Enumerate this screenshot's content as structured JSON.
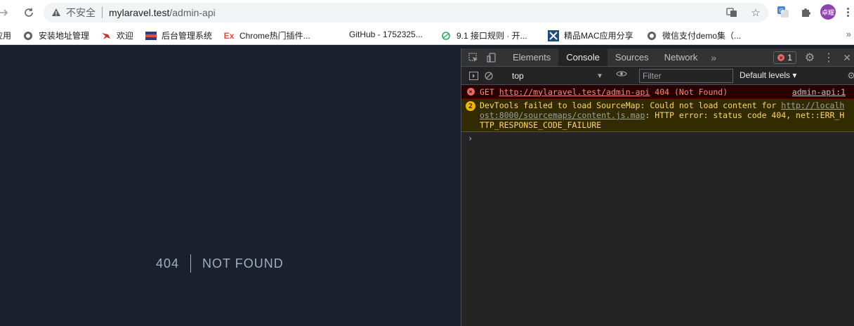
{
  "browser": {
    "security_label": "不安全",
    "url_host": "mylaravel.test",
    "url_path": "/admin-api",
    "avatar_text": "卓耀"
  },
  "bookmarks": [
    {
      "label": "应用",
      "icon": "apps-icon"
    },
    {
      "label": "安装地址管理",
      "icon": "globe-icon"
    },
    {
      "label": "欢迎",
      "icon": "bird-icon"
    },
    {
      "label": "后台管理系统",
      "icon": "flag-icon"
    },
    {
      "label": "Chrome热门插件...",
      "icon": "ex-icon",
      "icon_text": "Ex"
    },
    {
      "label": "GitHub - 1752325...",
      "icon": "none"
    },
    {
      "label": "9.1 接口规则 · 开...",
      "icon": "leaf-icon"
    },
    {
      "label": "精品MAC应用分享",
      "icon": "x-icon"
    },
    {
      "label": "微信支付demo集（...",
      "icon": "globe-icon"
    }
  ],
  "bookmarks_more": "»",
  "page": {
    "code": "404",
    "message": "NOT FOUND"
  },
  "devtools": {
    "tabs": [
      {
        "label": "Elements",
        "active": false
      },
      {
        "label": "Console",
        "active": true
      },
      {
        "label": "Sources",
        "active": false
      },
      {
        "label": "Network",
        "active": false
      }
    ],
    "more_tabs": "»",
    "error_count": "1",
    "context": "top",
    "filter_placeholder": "Filter",
    "levels": "Default levels ▾",
    "error_message": {
      "method": "GET",
      "url": "http://mylaravel.test/admin-api",
      "status": "404 (Not Found)",
      "source": "admin-api:1"
    },
    "warning_message": {
      "count": "2",
      "prefix": "DevTools failed to load SourceMap: Could not load content for ",
      "url": "http://localhost:8000/sourcemaps/content.js.map",
      "suffix": ": HTTP error: status code 404, net::ERR_HTTP_RESPONSE_CODE_FAILURE"
    },
    "prompt": "›"
  }
}
